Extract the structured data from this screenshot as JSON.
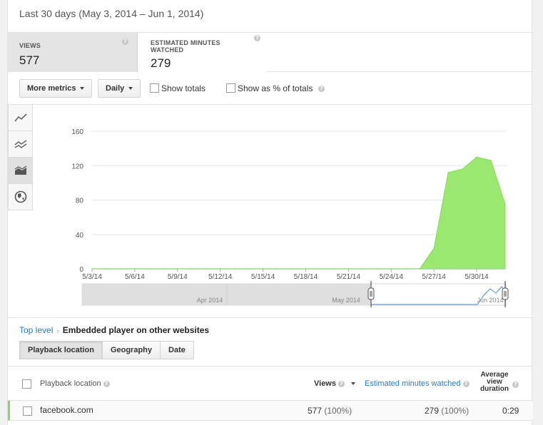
{
  "date_range": "Last 30 days (May 3, 2014 – Jun 1, 2014)",
  "metrics": [
    {
      "label": "VIEWS",
      "value": "577"
    },
    {
      "label": "ESTIMATED MINUTES WATCHED",
      "value": "279"
    }
  ],
  "toolbar": {
    "more_metrics": "More metrics",
    "interval": "Daily",
    "show_totals": "Show totals",
    "show_pct": "Show as % of totals"
  },
  "sidebar_icons": [
    "line-chart-icon",
    "multi-line-chart-icon",
    "stacked-area-chart-icon",
    "globe-icon"
  ],
  "chart_data": {
    "type": "area",
    "title": "",
    "xlabel": "",
    "ylabel": "",
    "x_ticks": [
      "5/3/14",
      "5/6/14",
      "5/9/14",
      "5/12/14",
      "5/15/14",
      "5/18/14",
      "5/21/14",
      "5/24/14",
      "5/27/14",
      "5/30/14"
    ],
    "y_ticks": [
      "0",
      "40",
      "80",
      "120",
      "160"
    ],
    "ylim": [
      0,
      160
    ],
    "grid": true,
    "color": "#9be870",
    "x": [
      "5/3/14",
      "5/4/14",
      "5/5/14",
      "5/6/14",
      "5/7/14",
      "5/8/14",
      "5/9/14",
      "5/10/14",
      "5/11/14",
      "5/12/14",
      "5/13/14",
      "5/14/14",
      "5/15/14",
      "5/16/14",
      "5/17/14",
      "5/18/14",
      "5/19/14",
      "5/20/14",
      "5/21/14",
      "5/22/14",
      "5/23/14",
      "5/24/14",
      "5/25/14",
      "5/26/14",
      "5/27/14",
      "5/28/14",
      "5/29/14",
      "5/30/14",
      "5/31/14",
      "6/1/14"
    ],
    "series": [
      {
        "values": [
          0,
          0,
          0,
          0,
          0,
          0,
          0,
          0,
          0,
          0,
          0,
          0,
          0,
          0,
          0,
          0,
          0,
          0,
          0,
          0,
          0,
          0,
          0,
          0,
          24,
          112,
          116,
          130,
          126,
          75
        ]
      }
    ],
    "navigator": {
      "labels": [
        "Apr 2014",
        "May 2014",
        "Jun 2014"
      ]
    }
  },
  "breadcrumb": {
    "top": "Top level",
    "current": "Embedded player on other websites"
  },
  "tabs": [
    "Playback location",
    "Geography",
    "Date"
  ],
  "table": {
    "headers": {
      "location": "Playback location",
      "views": "Views",
      "minutes": "Estimated minutes watched",
      "avg_duration": "Average view duration"
    },
    "rows": [
      {
        "location": "facebook.com",
        "views": "577",
        "views_pct": "(100%)",
        "minutes": "279",
        "minutes_pct": "(100%)",
        "avg_duration": "0:29"
      }
    ]
  }
}
